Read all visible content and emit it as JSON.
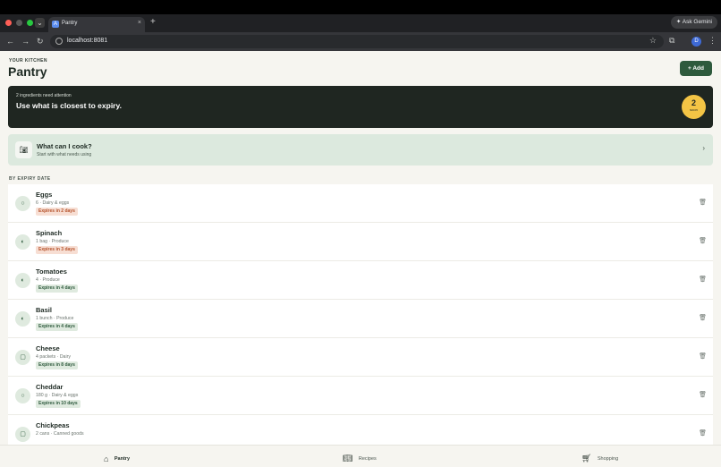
{
  "browser": {
    "tab_title": "Pantry",
    "tab_close": "×",
    "new_tab": "+",
    "ask_gemini": "✦ Ask Gemini",
    "url": "localhost:8081",
    "profile_initial": "D"
  },
  "header": {
    "eyebrow": "YOUR KITCHEN",
    "title": "Pantry",
    "add_label": "+ Add"
  },
  "attention": {
    "subtitle": "2 ingredients need attention",
    "title": "Use what is closest to expiry.",
    "badge_count": "2",
    "badge_label": "soon"
  },
  "cook": {
    "title": "What can I cook?",
    "subtitle": "Start with what needs using"
  },
  "section_label": "BY EXPIRY DATE",
  "items": [
    {
      "name": "Eggs",
      "meta": "6 · Dairy & eggs",
      "badge": "Expires in 2 days",
      "status": "warn",
      "icon": "egg-icon"
    },
    {
      "name": "Spinach",
      "meta": "1 bag · Produce",
      "badge": "Expires in 3 days",
      "status": "warn",
      "icon": "leaf-icon"
    },
    {
      "name": "Tomatoes",
      "meta": "4 · Produce",
      "badge": "Expires in 4 days",
      "status": "ok",
      "icon": "leaf-icon"
    },
    {
      "name": "Basil",
      "meta": "1 bunch · Produce",
      "badge": "Expires in 4 days",
      "status": "ok",
      "icon": "leaf-icon"
    },
    {
      "name": "Cheese",
      "meta": "4 packets · Dairy",
      "badge": "Expires in 8 days",
      "status": "ok",
      "icon": "box-icon"
    },
    {
      "name": "Cheddar",
      "meta": "180 g · Dairy & eggs",
      "badge": "Expires in 10 days",
      "status": "ok",
      "icon": "egg-icon"
    },
    {
      "name": "Chickpeas",
      "meta": "2 cans · Canned goods",
      "badge": "",
      "status": "ok",
      "icon": "box-icon"
    }
  ],
  "bottom_nav": {
    "pantry": "Pantry",
    "recipes": "Recipes",
    "shopping": "Shopping"
  },
  "colors": {
    "primary": "#2e5a3d",
    "banner": "#1f2621",
    "accent_badge": "#f3c445",
    "warn": "#b5532c"
  }
}
